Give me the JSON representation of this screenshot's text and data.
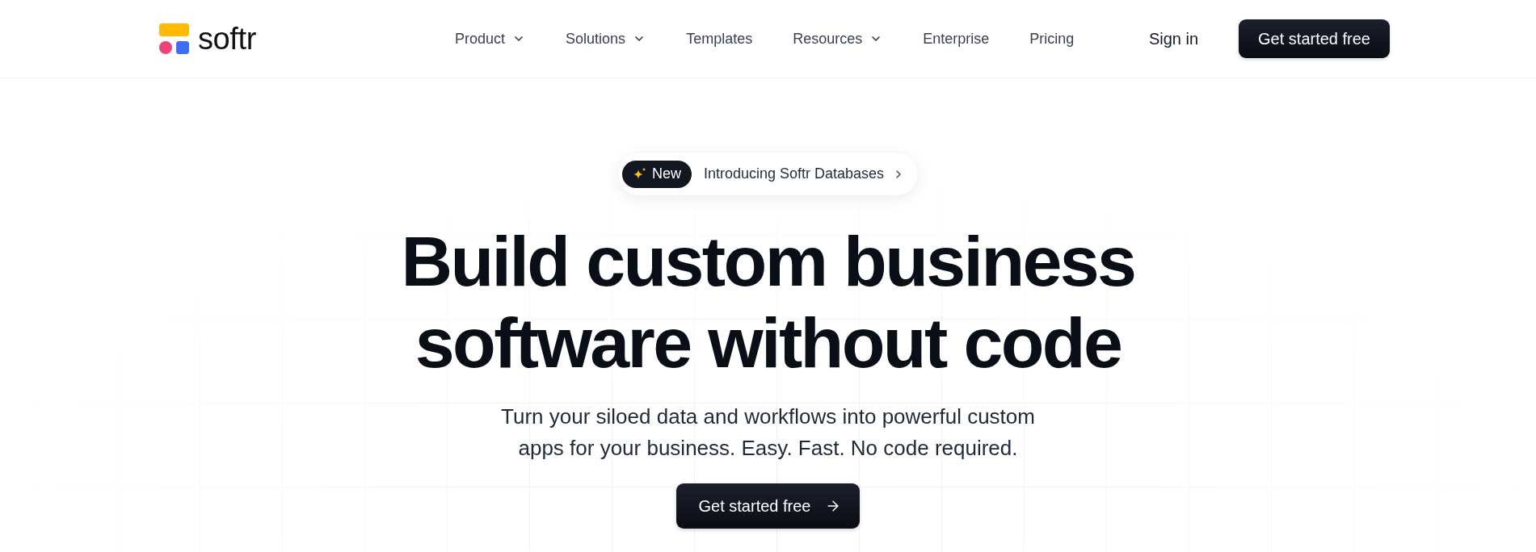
{
  "header": {
    "logo": {
      "text": "softr"
    },
    "nav": [
      {
        "label": "Product",
        "dropdown": true
      },
      {
        "label": "Solutions",
        "dropdown": true
      },
      {
        "label": "Templates",
        "dropdown": false
      },
      {
        "label": "Resources",
        "dropdown": true
      },
      {
        "label": "Enterprise",
        "dropdown": false
      },
      {
        "label": "Pricing",
        "dropdown": false
      }
    ],
    "sign_in": "Sign in",
    "cta": "Get started free"
  },
  "hero": {
    "announcement": {
      "tag": "New",
      "text": "Introducing Softr Databases"
    },
    "title": "Build custom business software without code",
    "subtitle": "Turn your siloed data and workflows into powerful custom apps for your business. Easy. Fast. No code required.",
    "cta": "Get started free"
  }
}
